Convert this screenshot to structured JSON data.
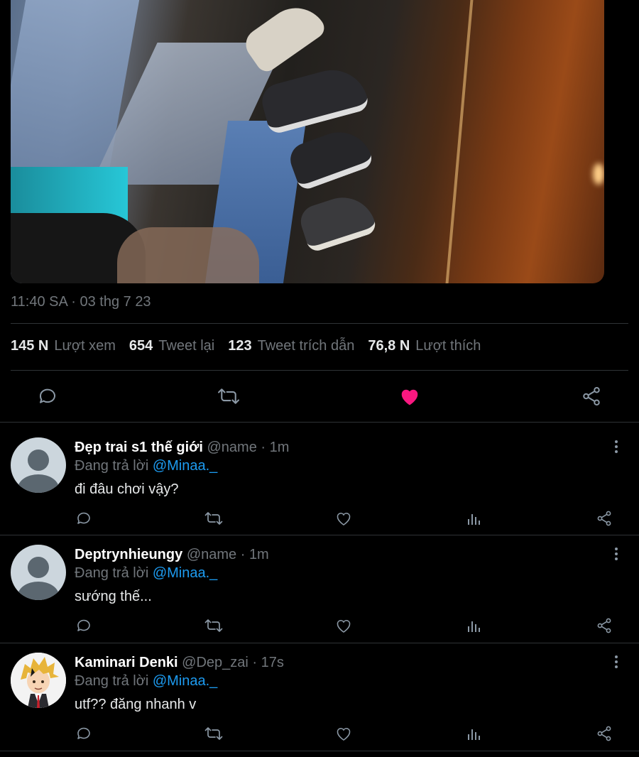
{
  "tweet": {
    "timestamp": "11:40 SA · 03 thg 7 23",
    "stats": [
      {
        "num": "145 N",
        "label": "Lượt xem"
      },
      {
        "num": "654",
        "label": "Tweet lại"
      },
      {
        "num": "123",
        "label": "Tweet trích dẫn"
      },
      {
        "num": "76,8 N",
        "label": "Lượt thích"
      }
    ],
    "liked": true,
    "like_color": "#f91880",
    "accent_color": "#1d9bf0"
  },
  "replies": [
    {
      "name": "Đẹp trai s1 thế giới",
      "handle": "@name",
      "time": "1m",
      "replying_prefix": "Đang trả lời",
      "replying_to": "@Minaa._",
      "text": "đi đâu chơi vậy?",
      "avatar": "default-avatar-icon"
    },
    {
      "name": "Deptrynhieungy",
      "handle": "@name",
      "time": "1m",
      "replying_prefix": "Đang trả lời",
      "replying_to": "@Minaa._",
      "text": "sướng thế...",
      "avatar": "default-avatar-icon"
    },
    {
      "name": "Kaminari Denki",
      "handle": "@Dep_zai",
      "time": "17s",
      "replying_prefix": "Đang trả lời",
      "replying_to": "@Minaa._",
      "text": "utf?? đăng nhanh v",
      "avatar": "anime-avatar"
    }
  ],
  "sep": " · "
}
